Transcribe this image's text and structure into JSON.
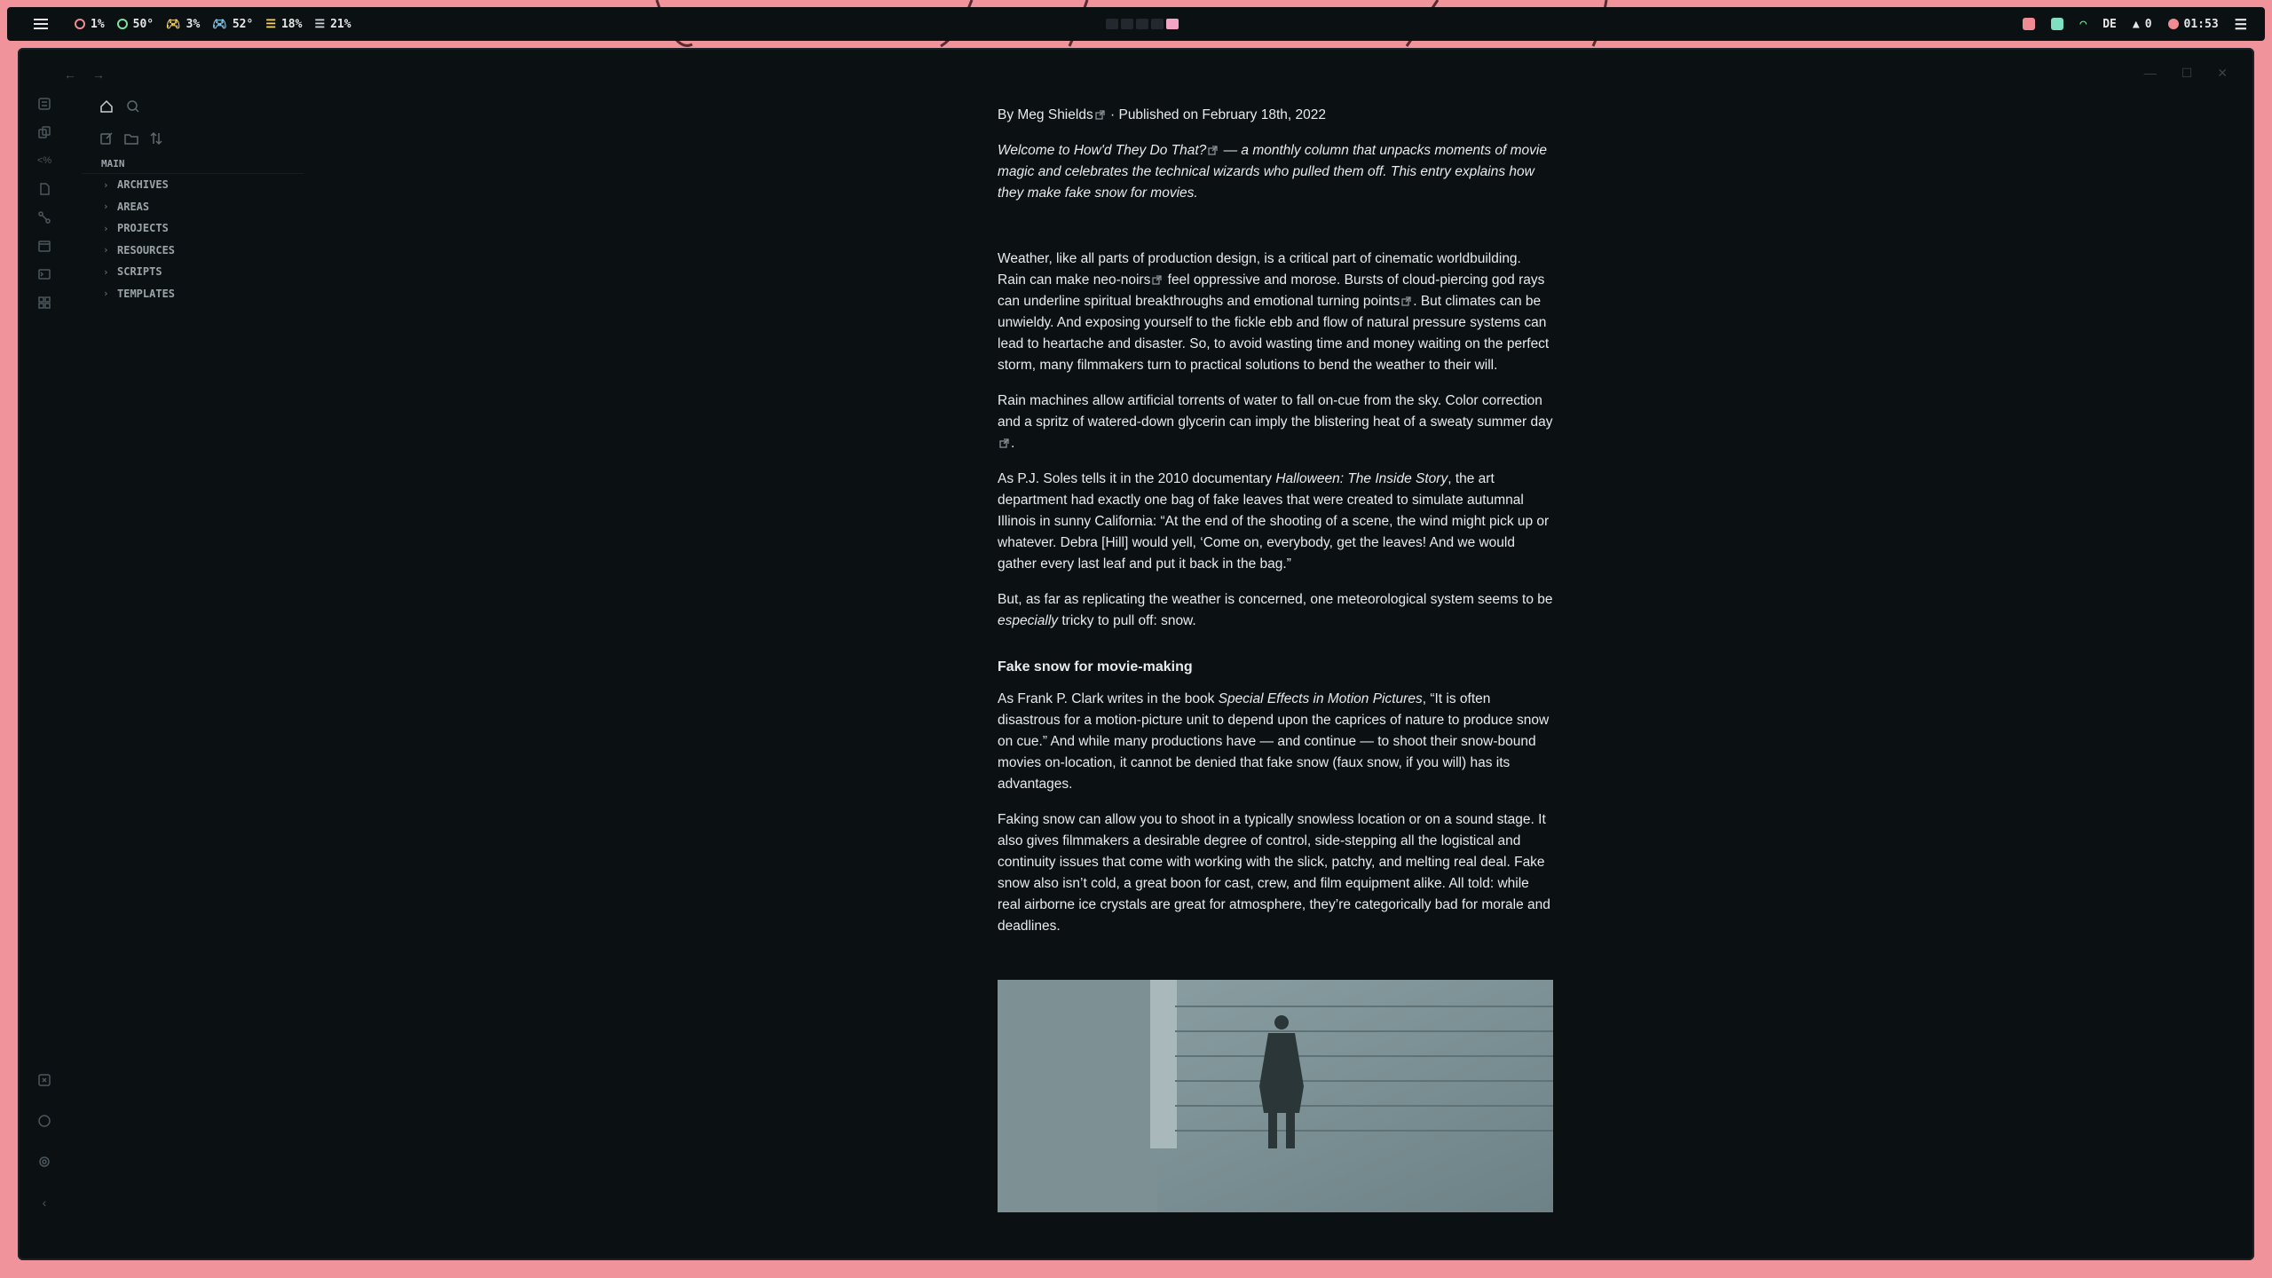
{
  "statusbar": {
    "cpu": "1%",
    "cpu_temp": "50°",
    "gpu": "3%",
    "gpu_temp": "52°",
    "mem": "18%",
    "disk": "21%",
    "lang": "DE",
    "notifications": "0",
    "clock": "01:53"
  },
  "colors": {
    "accent_pink": "#f3a5c4",
    "wallpaper": "#f0939a",
    "window_bg": "#0b1013"
  },
  "explorer": {
    "section": "MAIN",
    "folders": [
      "ARCHIVES",
      "AREAS",
      "PROJECTS",
      "RESOURCES",
      "SCRIPTS",
      "TEMPLATES"
    ]
  },
  "article": {
    "byline_author": "By Meg Shields",
    "byline_date": " · Published on February 18th, 2022",
    "lead_1": "Welcome to ",
    "lead_link": "How'd They Do That?",
    "lead_2": " — a monthly column that unpacks moments of movie magic and celebrates the technical wizards who pulled them off. This entry explains how they make fake snow for movies.",
    "p1_a": "Weather, like all parts of production design, is a critical part of cinematic worldbuilding. Rain can make ",
    "p1_link1": "neo-noirs",
    "p1_b": " feel oppressive and morose. Bursts of cloud-piercing god rays can underline spiritual breakthroughs and emotional ",
    "p1_link2": "turning points",
    "p1_c": ". But climates can be unwieldy. And exposing yourself to the fickle ebb and flow of natural pressure systems can lead to heartache and disaster. So, to avoid wasting time and money waiting on the perfect storm, many filmmakers turn to practical solutions to bend the weather to their will.",
    "p2_a": "Rain machines allow artificial torrents of water to fall on-cue from the sky. Color correction and a spritz of watered-down glycerin can imply the blistering heat of a ",
    "p2_link": "sweaty summer day",
    "p2_b": ".",
    "p3_a": "As P.J. Soles tells it in the 2010 documentary ",
    "p3_em": "Halloween: The Inside Story",
    "p3_b": ", the art department had exactly one bag of fake leaves that were created to simulate autumnal Illinois in sunny California: “At the end of the shooting of a scene, the wind might pick up or whatever. Debra [Hill] would yell, ‘Come on, everybody, get the leaves! And we would gather every last leaf and put it back in the bag.”",
    "p4_a": "But, as far as replicating the weather is concerned, one meteorological system seems to be ",
    "p4_em": "especially",
    "p4_b": " tricky to pull off: snow.",
    "heading": "Fake snow for movie-making",
    "p5_a": "As Frank P. Clark writes in the book ",
    "p5_em": "Special Effects in Motion Pictures",
    "p5_b": ", “It is often disastrous for a motion-picture unit to depend upon the caprices of nature to produce snow on cue.” And while many productions have — and continue — to shoot their snow-bound movies on-location, it cannot be denied that fake snow (faux snow, if you will) has its advantages.",
    "p6": "Faking snow can allow you to shoot in a typically snowless location or on a sound stage. It also gives filmmakers a desirable degree of control, side-stepping all the logistical and continuity issues that come with working with the slick, patchy, and melting real deal. Fake snow also isn’t cold, a great boon for cast, crew, and film equipment alike. All told: while real airborne ice crystals are great for atmosphere, they’re categorically bad for morale and deadlines."
  }
}
